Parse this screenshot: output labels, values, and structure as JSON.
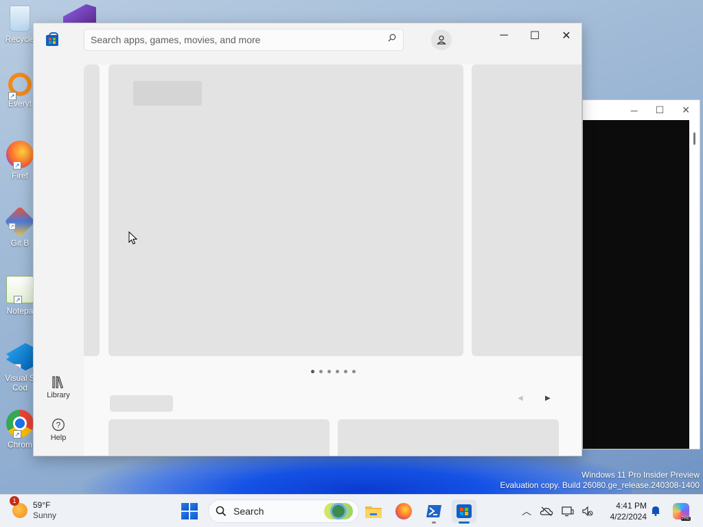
{
  "desktop": {
    "icons": [
      {
        "label": "Recycle",
        "icon": "recycle-bin-icon"
      },
      {
        "label": "Everyt",
        "icon": "everything-search-icon"
      },
      {
        "label": "Firef",
        "icon": "firefox-icon"
      },
      {
        "label": "Git B",
        "icon": "git-bash-icon"
      },
      {
        "label": "Notepa",
        "icon": "notepad-plus-plus-icon"
      },
      {
        "label": "Visual S",
        "label2": "Cod",
        "icon": "vscode-icon"
      },
      {
        "label": "Chrom",
        "icon": "chrome-icon"
      }
    ],
    "watermark": {
      "line1": "Windows 11 Pro Insider Preview",
      "line2": "Evaluation copy. Build 26080.ge_release.240308-1400"
    }
  },
  "store_window": {
    "search": {
      "placeholder": "Search apps, games, movies, and more",
      "value": ""
    },
    "sidebar": {
      "library_label": "Library",
      "help_label": "Help"
    },
    "controls": {
      "minimize": "─",
      "maximize": "☐",
      "close": "✕"
    },
    "carousel": {
      "page_count": 6,
      "active_index": 0
    }
  },
  "taskbar": {
    "weather": {
      "temperature": "59°F",
      "condition": "Sunny",
      "badge": "1"
    },
    "search_label": "Search",
    "clock": {
      "time": "4:41 PM",
      "date": "4/22/2024"
    },
    "copilot_badge": "PRE",
    "accent": "#0f6cbd"
  }
}
